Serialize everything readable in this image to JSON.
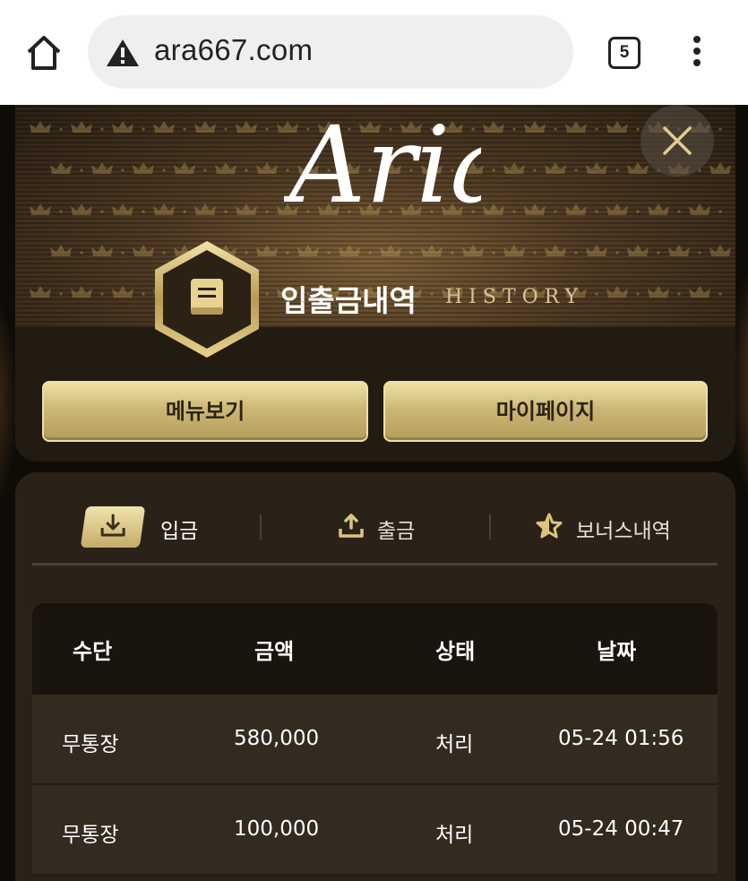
{
  "browser": {
    "url": "ara667.com",
    "tab_count": "5",
    "icons": [
      "home-icon",
      "warning-icon",
      "tabs-icon",
      "more-vert-icon"
    ]
  },
  "header": {
    "logo_text": "Aria",
    "title_kr": "입출금내역",
    "title_en": "HISTORY",
    "menu_button": "메뉴보기",
    "mypage_button": "마이페이지"
  },
  "tabs": [
    {
      "label": "입금",
      "icon": "download-icon",
      "active": true
    },
    {
      "label": "출금",
      "icon": "upload-icon",
      "active": false
    },
    {
      "label": "보너스내역",
      "icon": "star-icon",
      "active": false
    }
  ],
  "table": {
    "columns": [
      "수단",
      "금액",
      "상태",
      "날짜"
    ],
    "rows": [
      [
        "무통장",
        "580,000",
        "처리",
        "05-24 01:56"
      ],
      [
        "무통장",
        "100,000",
        "처리",
        "05-24 00:47"
      ]
    ]
  },
  "colors": {
    "gold": "#cdb774",
    "background": "#0f0c08",
    "panel": "#2a2219",
    "header_row": "#1a140e"
  }
}
